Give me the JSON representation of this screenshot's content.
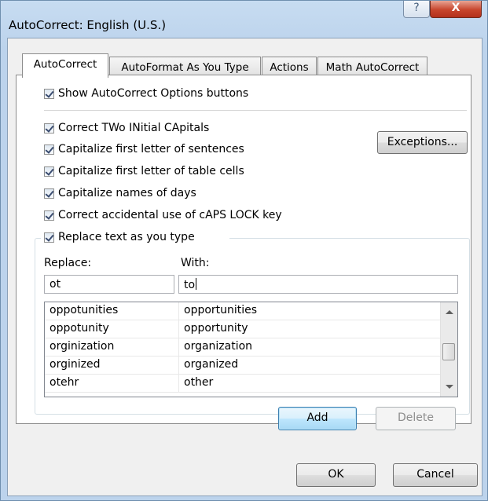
{
  "window": {
    "title": "AutoCorrect: English (U.S.)",
    "help_glyph": "?",
    "close_glyph": "X"
  },
  "tabs": [
    {
      "label": "AutoCorrect",
      "active": true
    },
    {
      "label": "AutoFormat As You Type",
      "active": false
    },
    {
      "label": "Actions",
      "active": false
    },
    {
      "label": "Math AutoCorrect",
      "active": false
    }
  ],
  "options": {
    "show_buttons": {
      "label": "Show AutoCorrect Options buttons",
      "checked": true
    },
    "two_initial_caps": {
      "label": "Correct TWo INitial CApitals",
      "checked": true
    },
    "cap_sentences": {
      "label": "Capitalize first letter of sentences",
      "checked": true
    },
    "cap_table_cells": {
      "label": "Capitalize first letter of table cells",
      "checked": true
    },
    "cap_days": {
      "label": "Capitalize names of days",
      "checked": true
    },
    "caps_lock": {
      "label": "Correct accidental use of cAPS LOCK key",
      "checked": true
    },
    "replace_text": {
      "label": "Replace text as you type",
      "checked": true
    }
  },
  "exceptions_button": "Exceptions...",
  "replace": {
    "label": "Replace:",
    "value": "ot"
  },
  "with": {
    "label": "With:",
    "value": "to"
  },
  "entries": [
    {
      "replace": "oppotunities",
      "with": "opportunities"
    },
    {
      "replace": "oppotunity",
      "with": "opportunity"
    },
    {
      "replace": "orginization",
      "with": "organization"
    },
    {
      "replace": "orginized",
      "with": "organized"
    },
    {
      "replace": "otehr",
      "with": "other"
    }
  ],
  "buttons": {
    "add": "Add",
    "delete": "Delete",
    "ok": "OK",
    "cancel": "Cancel"
  }
}
